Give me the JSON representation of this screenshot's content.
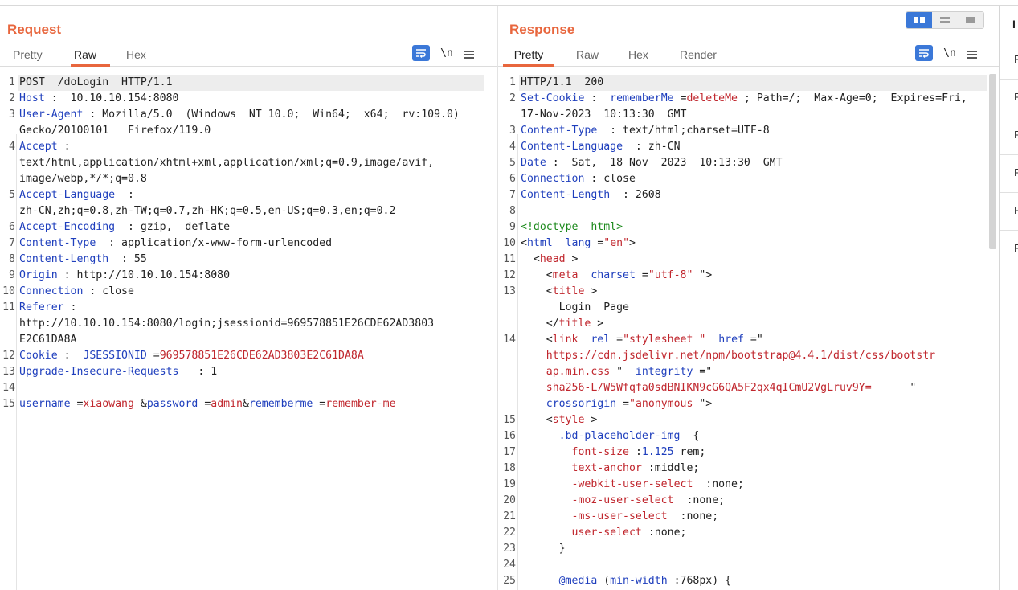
{
  "request": {
    "title": "Request",
    "tabs": [
      {
        "label": "Pretty",
        "active": false
      },
      {
        "label": "Raw",
        "active": true
      },
      {
        "label": "Hex",
        "active": false
      }
    ],
    "tools": {
      "wrap_icon": "wrap-lines-icon",
      "newline_label": "\\n",
      "menu_icon": "hamburger-menu-icon"
    }
  },
  "response": {
    "title": "Response",
    "tabs": [
      {
        "label": "Pretty",
        "active": true
      },
      {
        "label": "Raw",
        "active": false
      },
      {
        "label": "Hex",
        "active": false
      },
      {
        "label": "Render",
        "active": false
      }
    ],
    "tools": {
      "wrap_icon": "wrap-lines-icon",
      "newline_label": "\\n",
      "menu_icon": "hamburger-menu-icon"
    }
  },
  "layout_toggle": {
    "icons": [
      "split-columns-icon",
      "split-rows-icon",
      "single-pane-icon"
    ],
    "active": 0
  },
  "side_panel": {
    "header": "I",
    "rows": [
      "R",
      "R",
      "R",
      "R",
      "R",
      "R"
    ]
  },
  "request_lines": [
    {
      "n": "1",
      "parts": [
        [
          "p",
          "POST  /doLogin  HTTP/1.1"
        ]
      ]
    },
    {
      "n": "2",
      "parts": [
        [
          "k",
          "Host"
        ],
        [
          "p",
          " :  10.10.10.154:8080"
        ]
      ]
    },
    {
      "n": "3",
      "parts": [
        [
          "k",
          "User-Agent"
        ],
        [
          "p",
          " : Mozilla/5.0  (Windows  NT 10.0;  Win64;  x64;  rv:109.0)"
        ]
      ]
    },
    {
      "n": "",
      "parts": [
        [
          "p",
          "Gecko/20100101   Firefox/119.0"
        ]
      ]
    },
    {
      "n": "4",
      "parts": [
        [
          "k",
          "Accept"
        ],
        [
          "p",
          " :"
        ]
      ]
    },
    {
      "n": "",
      "parts": [
        [
          "p",
          "text/html,application/xhtml+xml,application/xml;q=0.9,image/avif,"
        ]
      ]
    },
    {
      "n": "",
      "parts": [
        [
          "p",
          "image/webp,*/*;q=0.8"
        ]
      ]
    },
    {
      "n": "5",
      "parts": [
        [
          "k",
          "Accept-Language"
        ],
        [
          "p",
          "  :"
        ]
      ]
    },
    {
      "n": "",
      "parts": [
        [
          "p",
          "zh-CN,zh;q=0.8,zh-TW;q=0.7,zh-HK;q=0.5,en-US;q=0.3,en;q=0.2"
        ]
      ]
    },
    {
      "n": "6",
      "parts": [
        [
          "k",
          "Accept-Encoding"
        ],
        [
          "p",
          "  : gzip,  deflate"
        ]
      ]
    },
    {
      "n": "7",
      "parts": [
        [
          "k",
          "Content-Type"
        ],
        [
          "p",
          "  : application/x-www-form-urlencoded"
        ]
      ]
    },
    {
      "n": "8",
      "parts": [
        [
          "k",
          "Content-Length"
        ],
        [
          "p",
          "  : 55"
        ]
      ]
    },
    {
      "n": "9",
      "parts": [
        [
          "k",
          "Origin"
        ],
        [
          "p",
          " : http://10.10.10.154:8080"
        ]
      ]
    },
    {
      "n": "10",
      "parts": [
        [
          "k",
          "Connection"
        ],
        [
          "p",
          " : close"
        ]
      ]
    },
    {
      "n": "11",
      "parts": [
        [
          "k",
          "Referer"
        ],
        [
          "p",
          " :"
        ]
      ]
    },
    {
      "n": "",
      "parts": [
        [
          "p",
          "http://10.10.10.154:8080/login;jsessionid=969578851E26CDE62AD3803"
        ]
      ]
    },
    {
      "n": "",
      "parts": [
        [
          "p",
          "E2C61DA8A"
        ]
      ]
    },
    {
      "n": "12",
      "parts": [
        [
          "k",
          "Cookie"
        ],
        [
          "p",
          " :  "
        ],
        [
          "k",
          "JSESSIONID"
        ],
        [
          "p",
          " ="
        ],
        [
          "v",
          "969578851E26CDE62AD3803E2C61DA8A"
        ]
      ]
    },
    {
      "n": "13",
      "parts": [
        [
          "k",
          "Upgrade-Insecure-Requests"
        ],
        [
          "p",
          "   : 1"
        ]
      ]
    },
    {
      "n": "14",
      "parts": []
    },
    {
      "n": "15",
      "parts": [
        [
          "k",
          "username"
        ],
        [
          "p",
          " ="
        ],
        [
          "v",
          "xiaowang"
        ],
        [
          "p",
          " &"
        ],
        [
          "k",
          "password"
        ],
        [
          "p",
          " ="
        ],
        [
          "v",
          "admin"
        ],
        [
          "p",
          "&"
        ],
        [
          "k",
          "rememberme"
        ],
        [
          "p",
          " ="
        ],
        [
          "v",
          "remember-me"
        ]
      ]
    }
  ],
  "response_lines": [
    {
      "n": "1",
      "parts": [
        [
          "p",
          "HTTP/1.1  200"
        ]
      ]
    },
    {
      "n": "2",
      "parts": [
        [
          "k",
          "Set-Cookie"
        ],
        [
          "p",
          " :  "
        ],
        [
          "k",
          "rememberMe"
        ],
        [
          "p",
          " ="
        ],
        [
          "v",
          "deleteMe"
        ],
        [
          "p",
          " ; Path=/;  Max-Age=0;  Expires=Fri,"
        ]
      ]
    },
    {
      "n": "",
      "parts": [
        [
          "p",
          "17-Nov-2023  10:13:30  GMT"
        ]
      ]
    },
    {
      "n": "3",
      "parts": [
        [
          "k",
          "Content-Type"
        ],
        [
          "p",
          "  : text/html;charset=UTF-8"
        ]
      ]
    },
    {
      "n": "4",
      "parts": [
        [
          "k",
          "Content-Language"
        ],
        [
          "p",
          "  : zh-CN"
        ]
      ]
    },
    {
      "n": "5",
      "parts": [
        [
          "k",
          "Date"
        ],
        [
          "p",
          " :  Sat,  18 Nov  2023  10:13:30  GMT"
        ]
      ]
    },
    {
      "n": "6",
      "parts": [
        [
          "k",
          "Connection"
        ],
        [
          "p",
          " : close"
        ]
      ]
    },
    {
      "n": "7",
      "parts": [
        [
          "k",
          "Content-Length"
        ],
        [
          "p",
          "  : 2608"
        ]
      ]
    },
    {
      "n": "8",
      "parts": []
    },
    {
      "n": "9",
      "parts": [
        [
          "g",
          "<!doctype  html>"
        ]
      ]
    },
    {
      "n": "10",
      "parts": [
        [
          "p",
          "<"
        ],
        [
          "k",
          "html"
        ],
        [
          "p",
          "  "
        ],
        [
          "k",
          "lang"
        ],
        [
          "p",
          " ="
        ],
        [
          "v",
          "\"en\""
        ],
        [
          "p",
          ">"
        ]
      ]
    },
    {
      "n": "11",
      "parts": [
        [
          "p",
          "  <"
        ],
        [
          "v",
          "head"
        ],
        [
          "p",
          " >"
        ]
      ]
    },
    {
      "n": "12",
      "parts": [
        [
          "p",
          "    <"
        ],
        [
          "v",
          "meta"
        ],
        [
          "p",
          "  "
        ],
        [
          "k",
          "charset"
        ],
        [
          "p",
          " ="
        ],
        [
          "v",
          "\"utf-8\""
        ],
        [
          "p",
          " \">"
        ]
      ]
    },
    {
      "n": "13",
      "parts": [
        [
          "p",
          "    <"
        ],
        [
          "v",
          "title"
        ],
        [
          "p",
          " >"
        ]
      ]
    },
    {
      "n": "",
      "parts": [
        [
          "p",
          "      Login  Page"
        ]
      ]
    },
    {
      "n": "",
      "parts": [
        [
          "p",
          "    </"
        ],
        [
          "v",
          "title"
        ],
        [
          "p",
          " >"
        ]
      ]
    },
    {
      "n": "14",
      "parts": [
        [
          "p",
          "    <"
        ],
        [
          "v",
          "link"
        ],
        [
          "p",
          "  "
        ],
        [
          "k",
          "rel"
        ],
        [
          "p",
          " ="
        ],
        [
          "v",
          "\"stylesheet \""
        ],
        [
          "p",
          "  "
        ],
        [
          "k",
          "href"
        ],
        [
          "p",
          " =\""
        ]
      ]
    },
    {
      "n": "",
      "parts": [
        [
          "v",
          "    https://cdn.jsdelivr.net/npm/bootstrap@4.4.1/dist/css/bootstr"
        ]
      ]
    },
    {
      "n": "",
      "parts": [
        [
          "v",
          "    ap.min.css "
        ],
        [
          "p",
          "\"  "
        ],
        [
          "k",
          "integrity"
        ],
        [
          "p",
          " =\""
        ]
      ]
    },
    {
      "n": "",
      "parts": [
        [
          "v",
          "    sha256-L/W5Wfqfa0sdBNIKN9cG6QA5F2qx4qICmU2VgLruv9Y="
        ],
        [
          "p",
          "      \""
        ]
      ]
    },
    {
      "n": "",
      "parts": [
        [
          "p",
          "    "
        ],
        [
          "k",
          "crossorigin"
        ],
        [
          "p",
          " ="
        ],
        [
          "v",
          "\"anonymous "
        ],
        [
          "p",
          "\">"
        ]
      ]
    },
    {
      "n": "15",
      "parts": [
        [
          "p",
          "    <"
        ],
        [
          "v",
          "style"
        ],
        [
          "p",
          " >"
        ]
      ]
    },
    {
      "n": "16",
      "parts": [
        [
          "p",
          "      "
        ],
        [
          "k",
          ".bd-placeholder-img"
        ],
        [
          "p",
          "  {"
        ]
      ]
    },
    {
      "n": "17",
      "parts": [
        [
          "p",
          "        "
        ],
        [
          "v",
          "font-size"
        ],
        [
          "p",
          " :"
        ],
        [
          "k",
          "1.125"
        ],
        [
          "p",
          " rem;"
        ]
      ]
    },
    {
      "n": "18",
      "parts": [
        [
          "p",
          "        "
        ],
        [
          "v",
          "text-anchor"
        ],
        [
          "p",
          " :middle;"
        ]
      ]
    },
    {
      "n": "19",
      "parts": [
        [
          "p",
          "        "
        ],
        [
          "v",
          "-webkit-user-select"
        ],
        [
          "p",
          "  :none;"
        ]
      ]
    },
    {
      "n": "20",
      "parts": [
        [
          "p",
          "        "
        ],
        [
          "v",
          "-moz-user-select"
        ],
        [
          "p",
          "  :none;"
        ]
      ]
    },
    {
      "n": "21",
      "parts": [
        [
          "p",
          "        "
        ],
        [
          "v",
          "-ms-user-select"
        ],
        [
          "p",
          "  :none;"
        ]
      ]
    },
    {
      "n": "22",
      "parts": [
        [
          "p",
          "        "
        ],
        [
          "v",
          "user-select"
        ],
        [
          "p",
          " :none;"
        ]
      ]
    },
    {
      "n": "23",
      "parts": [
        [
          "p",
          "      }"
        ]
      ]
    },
    {
      "n": "24",
      "parts": []
    },
    {
      "n": "25",
      "parts": [
        [
          "p",
          "      "
        ],
        [
          "k",
          "@media"
        ],
        [
          "p",
          " ("
        ],
        [
          "k",
          "min-width"
        ],
        [
          "p",
          " :768px) {"
        ]
      ]
    }
  ]
}
